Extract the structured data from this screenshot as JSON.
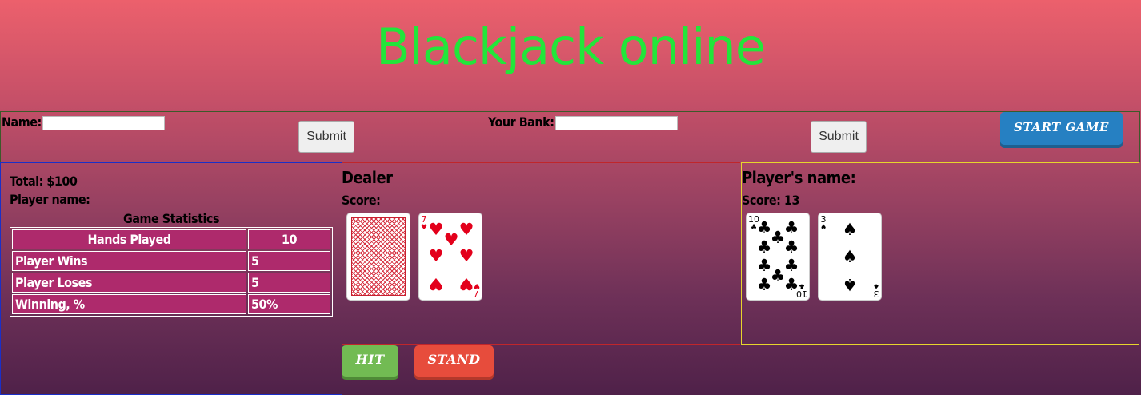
{
  "app": {
    "title": "Blackjack online"
  },
  "setup": {
    "name_label": "Name:",
    "name_value": "",
    "bank_label": "Your Bank:",
    "bank_value": "",
    "submit_label": "Submit",
    "start_label": "START GAME"
  },
  "stats": {
    "total": "Total: $100",
    "player_name": "Player name:",
    "title": "Game Statistics",
    "rows": [
      {
        "label": "Hands Played",
        "value": "10"
      },
      {
        "label": "Player Wins",
        "value": "5"
      },
      {
        "label": "Player Loses",
        "value": "5"
      },
      {
        "label": "Winning, %",
        "value": "50%"
      }
    ]
  },
  "dealer": {
    "title": "Dealer",
    "score": "Score:",
    "cards": [
      {
        "face_down": true
      },
      {
        "rank": "7",
        "suit": "hearts",
        "symbol": "♥",
        "color": "#e3001b"
      }
    ]
  },
  "player": {
    "title": "Player's name:",
    "score": "Score: 13",
    "cards": [
      {
        "rank": "10",
        "suit": "clubs",
        "symbol": "♣",
        "color": "#000000"
      },
      {
        "rank": "3",
        "suit": "spades",
        "symbol": "♠",
        "color": "#000000"
      }
    ]
  },
  "controls": {
    "hit_label": "HIT",
    "stand_label": "STAND"
  },
  "colors": {
    "title": "#22e63a",
    "start_button": "#2680c2",
    "hit_button": "#72bb53",
    "stand_button": "#e74c3c",
    "stats_cell": "#ae2a6c"
  }
}
